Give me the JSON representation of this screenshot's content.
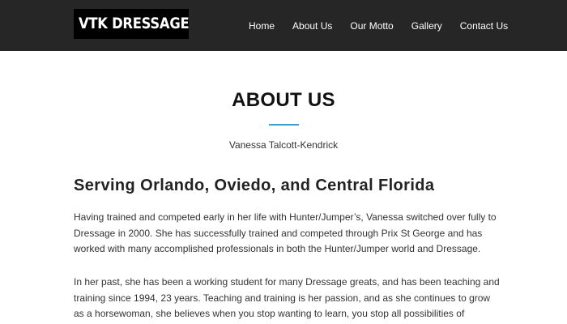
{
  "header": {
    "logo_text": "VTK DRESSAGE",
    "nav": [
      {
        "label": "Home"
      },
      {
        "label": "About Us"
      },
      {
        "label": "Our Motto"
      },
      {
        "label": "Gallery"
      },
      {
        "label": "Contact Us"
      }
    ]
  },
  "main": {
    "title": "ABOUT US",
    "subtitle": "Vanessa Talcott-Kendrick",
    "heading": "Serving Orlando, Oviedo, and Central Florida",
    "paragraphs": [
      "Having trained and competed early in her life with Hunter/Jumper’s, Vanessa switched over fully to Dressage in 2000. She has successfully trained and competed through Prix St George and has worked with many accomplished professionals in both the Hunter/Jumper world and Dressage.",
      "In her past, she has been a working student for many Dressage greats, and has been teaching and training since 1994, 23 years. Teaching and training is her passion, and as she continues to grow as a horsewoman, she believes when you stop wanting to learn, you stop all possibilities of"
    ]
  },
  "colors": {
    "header_bg": "#262626",
    "logo_bg": "#000000",
    "accent": "#29a8e0"
  }
}
